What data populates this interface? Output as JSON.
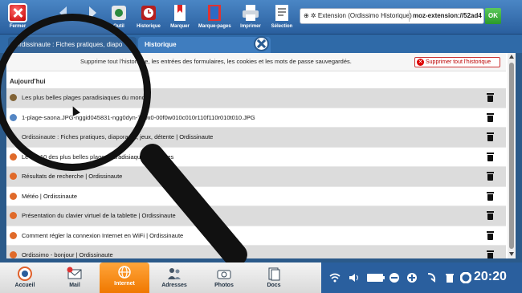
{
  "toolbar": {
    "buttons": [
      {
        "label": "Fermer",
        "icon": "close-icon"
      },
      {
        "label": "",
        "icon": "back-icon"
      },
      {
        "label": "",
        "icon": "forward-icon"
      },
      {
        "label": "Outil",
        "icon": "tool-icon"
      },
      {
        "label": "Historique",
        "icon": "history-icon"
      },
      {
        "label": "Marquer",
        "icon": "bookmark-add-icon"
      },
      {
        "label": "Marque-pages",
        "icon": "bookmarks-icon"
      },
      {
        "label": "Imprimer",
        "icon": "printer-icon"
      },
      {
        "label": "Sélection",
        "icon": "selection-icon"
      }
    ],
    "url_extension_label": "Extension (Ordissimo Historique)",
    "url_value": "moz-extension://52ad4",
    "ok_label": "OK"
  },
  "tabs": [
    {
      "label": "Ordissinaute : Fiches pratiques, diapo"
    },
    {
      "label": "Historique"
    }
  ],
  "notice": {
    "message": "Supprime tout l'historique, les entrées des formulaires, les cookies et les mots de passe sauvegardés.",
    "clear_all_label": "Supprimer tout l'historique"
  },
  "section_title": "Aujourd'hui",
  "history_items": [
    {
      "title": "Les plus belles plages paradisiaques du monde",
      "favicon_color": "#7a5a2a"
    },
    {
      "title": "1-plage-saona.JPG-nggid045831-ngg0dyn-720x0-00f0w010c010r110f110r010t010.JPG",
      "favicon_color": "#4a7fc1"
    },
    {
      "title": "Ordissinaute : Fiches pratiques, diaporama, jeux, détente | Ordissinaute",
      "favicon_color": "#cfcfcf"
    },
    {
      "title": "Le top 10 des plus belles plages paradisiaques à visitées",
      "favicon_color": "#e06a2a"
    },
    {
      "title": "Résultats de recherche | Ordissinaute",
      "favicon_color": "#e06a2a"
    },
    {
      "title": "Météo | Ordissinaute",
      "favicon_color": "#e06a2a"
    },
    {
      "title": "Présentation du clavier virtuel de la tablette | Ordissinaute",
      "favicon_color": "#e06a2a"
    },
    {
      "title": "Comment régler la connexion Internet en WiFi | Ordissinaute",
      "favicon_color": "#e06a2a"
    },
    {
      "title": "Ordissimo - bonjour | Ordissinaute",
      "favicon_color": "#e06a2a"
    }
  ],
  "taskbar": {
    "apps": [
      {
        "label": "Accueil",
        "icon": "home-logo-icon"
      },
      {
        "label": "Mail",
        "icon": "mail-icon",
        "badge": "1"
      },
      {
        "label": "Internet",
        "icon": "globe-icon"
      },
      {
        "label": "Adresses",
        "icon": "contacts-icon"
      },
      {
        "label": "Photos",
        "icon": "camera-icon"
      },
      {
        "label": "Docs",
        "icon": "documents-icon"
      }
    ],
    "active_app": "Internet",
    "clock": "20:20"
  }
}
